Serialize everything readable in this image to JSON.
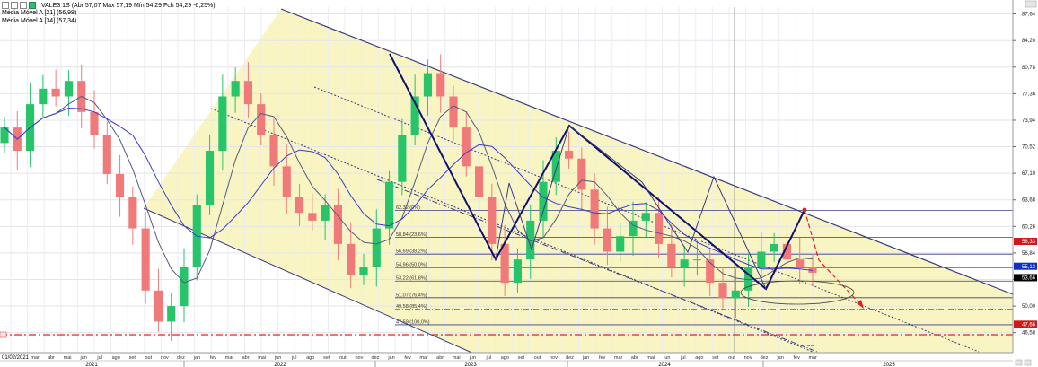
{
  "header": {
    "ticker": "VALE3 1S",
    "ohlc": "(Abr 57,07 Máx 57,19 Mín 54,29 Fch 54,29 -6,25%)",
    "ma1": "Média Móvel A [21] (56,98)",
    "ma2": "Média Móvel A [34] (57,34)"
  },
  "colors": {
    "up": "#27c46a",
    "down": "#f07a7a",
    "ma21": "#555a80",
    "ma34": "#3a3ad0",
    "channel_fill": "#f7f3b8",
    "zigzag": "#10106a",
    "fib_line": "#3b3b8c",
    "red_dash": "#e02020",
    "blue_badge": "#1030c0",
    "red_badge": "#d01818",
    "black_badge": "#000000"
  },
  "price_axis": {
    "ticks": [
      "87,64",
      "84,20",
      "80,78",
      "77,36",
      "73,94",
      "70,52",
      "67,10",
      "63,68",
      "60,26",
      "56,84",
      "53,42",
      "50,00",
      "46,58"
    ],
    "badges": [
      {
        "label": "58,33",
        "value": 58.33,
        "color": "red"
      },
      {
        "label": "55,13",
        "value": 55.13,
        "color": "blue"
      },
      {
        "label": "53,66",
        "value": 53.66,
        "color": "black"
      },
      {
        "label": "47,66",
        "value": 47.66,
        "color": "red"
      }
    ]
  },
  "date_axis": {
    "start_label": "01/02/2021",
    "months": [
      "mar",
      "abr",
      "mai",
      "jun",
      "jul",
      "ago",
      "set",
      "out",
      "nov",
      "dez",
      "jan",
      "fev",
      "mar",
      "abr",
      "mai",
      "jun",
      "jul",
      "ago",
      "set",
      "out",
      "nov",
      "dez",
      "jan",
      "fev",
      "mar",
      "abr",
      "mai",
      "jun",
      "jul",
      "ago",
      "set",
      "out",
      "nov",
      "dez",
      "jan",
      "fev",
      "mar",
      "abr",
      "mai",
      "jun",
      "jul",
      "ago",
      "set",
      "out",
      "nov",
      "dez",
      "jan",
      "fev",
      "mar"
    ],
    "years": [
      "2021",
      "2022",
      "2023",
      "2024",
      "2025"
    ]
  },
  "fibonacci": {
    "levels": [
      {
        "label": "62,32 (0%)",
        "value": 62.32
      },
      {
        "label": "58,84 (23,6%)",
        "value": 58.84
      },
      {
        "label": "56,69 (38,2%)",
        "value": 56.69
      },
      {
        "label": "54,96 (50,0%)",
        "value": 54.96
      },
      {
        "label": "53,22 (61,8%)",
        "value": 53.22
      },
      {
        "label": "51,07 (76,4%)",
        "value": 51.07
      },
      {
        "label": "49,58 (85,4%)",
        "value": 49.58
      },
      {
        "label": "47,59 (100,0%)",
        "value": 47.59
      }
    ]
  },
  "chart_data": {
    "type": "candlestick",
    "title": "",
    "ylim": [
      44.0,
      88.5
    ],
    "series": [
      {
        "name": "VALE3 1S",
        "kind": "weekly candles (approx.)",
        "close": [
          73,
          70,
          76,
          78,
          77,
          79,
          75,
          72,
          67,
          64,
          60,
          52,
          48,
          50,
          55,
          63,
          70,
          77,
          79,
          76,
          72,
          68,
          64,
          62,
          61,
          63,
          58,
          54,
          55,
          60,
          66,
          72,
          77,
          80,
          77,
          73,
          68,
          64,
          58,
          53,
          56,
          61,
          66,
          70,
          69,
          65,
          60,
          57,
          59,
          61,
          62,
          58,
          55,
          56,
          56,
          53,
          51,
          52,
          55,
          57,
          58,
          56,
          55,
          54.29
        ]
      },
      {
        "name": "Média Móvel A [21]",
        "last": 56.98
      },
      {
        "name": "Média Móvel A [34]",
        "last": 57.34
      }
    ]
  }
}
